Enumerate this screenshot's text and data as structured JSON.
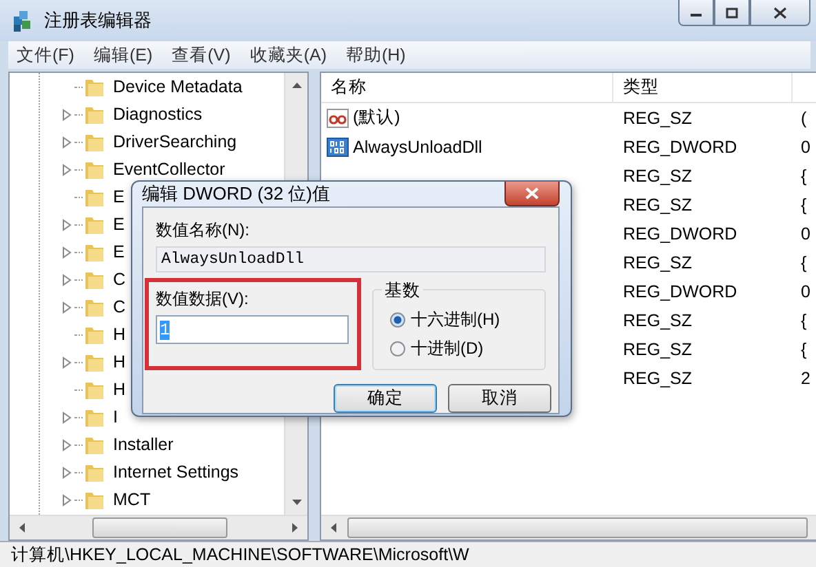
{
  "window": {
    "title": "注册表编辑器"
  },
  "menu": [
    "文件(F)",
    "编辑(E)",
    "查看(V)",
    "收藏夹(A)",
    "帮助(H)"
  ],
  "tree": {
    "items": [
      {
        "label": "Device Metadata",
        "expandable": false
      },
      {
        "label": "Diagnostics",
        "expandable": true
      },
      {
        "label": "DriverSearching",
        "expandable": true
      },
      {
        "label": "EventCollector",
        "expandable": true
      },
      {
        "label": "E",
        "expandable": false
      },
      {
        "label": "E",
        "expandable": true
      },
      {
        "label": "E",
        "expandable": true
      },
      {
        "label": "C",
        "expandable": true
      },
      {
        "label": "C",
        "expandable": true
      },
      {
        "label": "H",
        "expandable": false
      },
      {
        "label": "H",
        "expandable": true
      },
      {
        "label": "H",
        "expandable": false
      },
      {
        "label": "I",
        "expandable": true
      },
      {
        "label": "Installer",
        "expandable": true
      },
      {
        "label": "Internet Settings",
        "expandable": true
      },
      {
        "label": "MCT",
        "expandable": true
      }
    ]
  },
  "list": {
    "columns": [
      "名称",
      "类型"
    ],
    "rows": [
      {
        "kind": "string",
        "name": "(默认)",
        "type": "REG_SZ",
        "column_3": "("
      },
      {
        "kind": "number",
        "name": "AlwaysUnloadDll",
        "type": "REG_DWORD",
        "column_3": "0"
      },
      {
        "type": "REG_SZ",
        "column_3": "{"
      },
      {
        "type": "REG_SZ",
        "column_3": "{"
      },
      {
        "type": "REG_DWORD",
        "column_3": "0"
      },
      {
        "type": "REG_SZ",
        "column_3": "{"
      },
      {
        "type": "REG_DWORD",
        "column_3": "0"
      },
      {
        "type": "REG_SZ",
        "column_3": "{"
      },
      {
        "type": "REG_SZ",
        "column_3": "{"
      },
      {
        "type": "REG_SZ",
        "column_3": "2"
      }
    ]
  },
  "status_bar": "计算机\\HKEY_LOCAL_MACHINE\\SOFTWARE\\Microsoft\\W",
  "dialog": {
    "title": "编辑 DWORD (32 位)值",
    "name_label": "数值名称(N):",
    "name_value": "AlwaysUnloadDll",
    "data_label": "数值数据(V):",
    "data_value": "1",
    "data_selected": true,
    "base": {
      "label": "基数",
      "options": [
        {
          "label": "十六进制(H)",
          "selected": true
        },
        {
          "label": "十进制(D)",
          "selected": false
        }
      ]
    },
    "buttons": [
      {
        "label": "确定",
        "default": true
      },
      {
        "label": "取消",
        "default": false
      }
    ]
  }
}
